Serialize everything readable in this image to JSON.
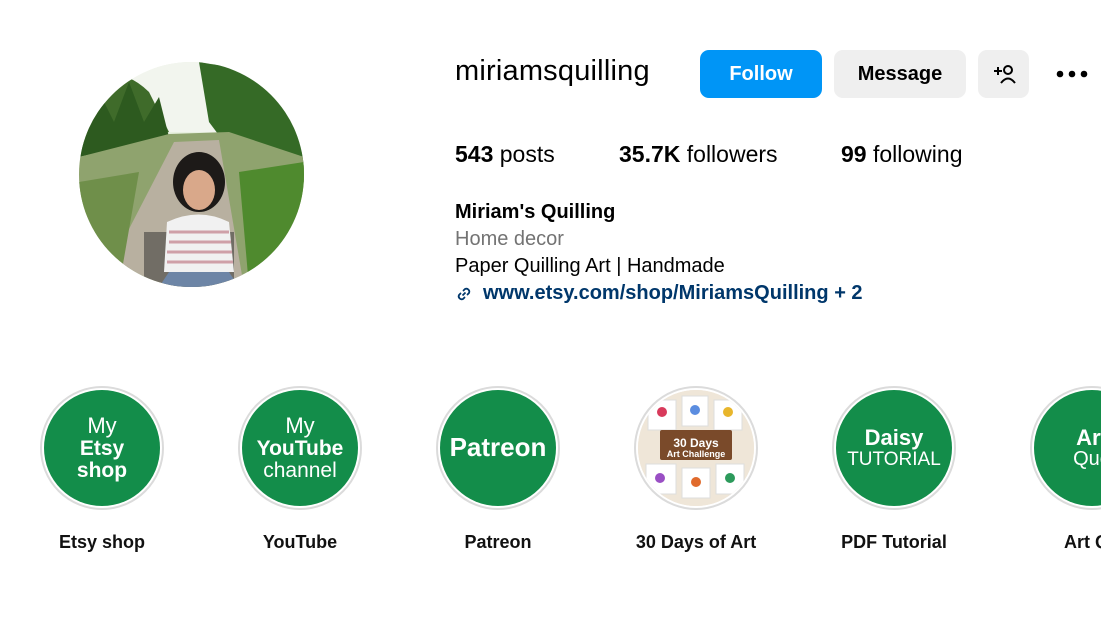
{
  "profile": {
    "username": "miriamsquilling",
    "follow_label": "Follow",
    "message_label": "Message",
    "stats": {
      "posts_count": "543",
      "posts_label": "posts",
      "followers_count": "35.7K",
      "followers_label": "followers",
      "following_count": "99",
      "following_label": "following"
    },
    "bio": {
      "name": "Miriam's Quilling",
      "category": "Home decor",
      "text": "Paper Quilling Art | Handmade",
      "link": "www.etsy.com/shop/MiriamsQuilling",
      "link_extra": "+ 2"
    }
  },
  "highlights": [
    {
      "label": "Etsy shop",
      "cover_lines": [
        "My",
        "Etsy",
        "shop"
      ]
    },
    {
      "label": "YouTube",
      "cover_lines": [
        "My",
        "YouTube",
        "channel"
      ]
    },
    {
      "label": "Patreon",
      "cover_lines": [
        "Patreon"
      ]
    },
    {
      "label": "30 Days of Art",
      "cover_lines": [
        "30 Days",
        "Art Challenge"
      ]
    },
    {
      "label": "PDF Tutorial",
      "cover_lines": [
        "Daisy",
        "TUTORIAL"
      ]
    },
    {
      "label": "Art Qu",
      "cover_lines": [
        "Art",
        "Quo"
      ]
    }
  ],
  "colors": {
    "accent": "#0095f6",
    "highlight_green": "#138d4a",
    "link": "#00376b",
    "secondary_text": "#737373"
  },
  "icons": [
    "add-user-icon",
    "more-options-icon",
    "link-icon"
  ]
}
